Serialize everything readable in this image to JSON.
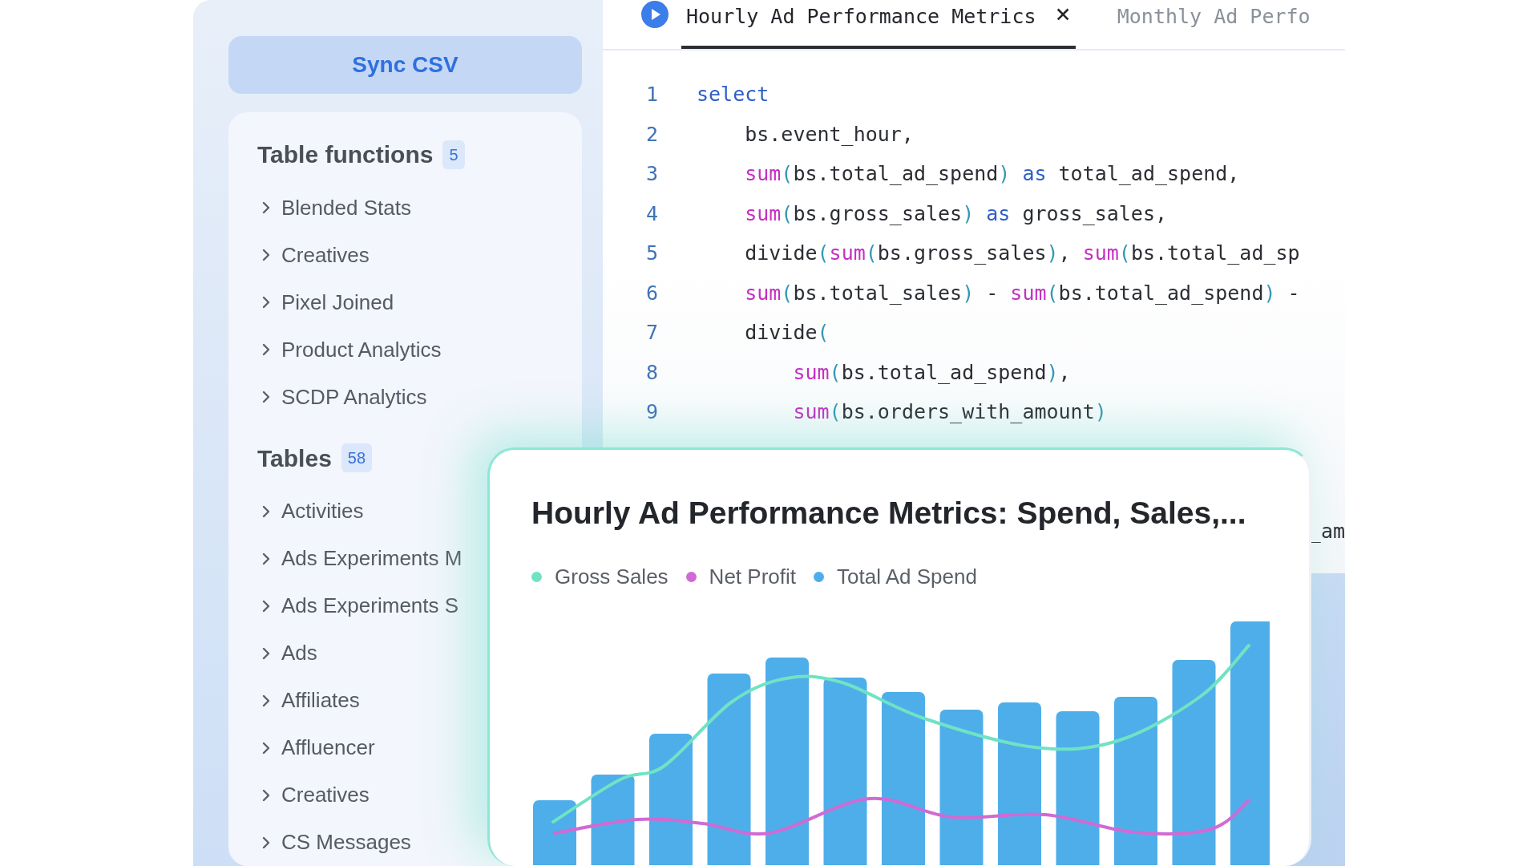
{
  "sidebar": {
    "sync_button": "Sync CSV",
    "sections": [
      {
        "title": "Table functions",
        "count": "5",
        "items": [
          "Blended Stats",
          "Creatives",
          "Pixel Joined",
          "Product Analytics",
          "SCDP Analytics"
        ]
      },
      {
        "title": "Tables",
        "count": "58",
        "items": [
          "Activities",
          "Ads Experiments M",
          "Ads Experiments S",
          "Ads",
          "Affiliates",
          "Affluencer",
          "Creatives",
          "CS Messages"
        ]
      }
    ]
  },
  "tabs": [
    {
      "label": "Hourly Ad Performance Metrics",
      "selected": true,
      "close": "×"
    },
    {
      "label": "Monthly Ad Perfo",
      "selected": false
    }
  ],
  "code": {
    "lines": [
      {
        "number": "1",
        "tokens": [
          {
            "kind": "kw",
            "text": "select"
          }
        ]
      },
      {
        "number": "2",
        "tokens": [
          {
            "kind": "plain",
            "text": "    bs.event_hour,"
          }
        ]
      },
      {
        "number": "3",
        "tokens": [
          {
            "kind": "fn",
            "text": "    sum"
          },
          {
            "kind": "paren",
            "text": "("
          },
          {
            "kind": "plain",
            "text": "bs.total_ad_spend"
          },
          {
            "kind": "paren",
            "text": ")"
          },
          {
            "kind": "kw",
            "text": " as"
          },
          {
            "kind": "plain",
            "text": " total_ad_spend,"
          }
        ]
      },
      {
        "number": "4",
        "tokens": [
          {
            "kind": "fn",
            "text": "    sum"
          },
          {
            "kind": "paren",
            "text": "("
          },
          {
            "kind": "plain",
            "text": "bs.gross_sales"
          },
          {
            "kind": "paren",
            "text": ")"
          },
          {
            "kind": "kw",
            "text": " as"
          },
          {
            "kind": "plain",
            "text": " gross_sales,"
          }
        ]
      },
      {
        "number": "5",
        "tokens": [
          {
            "kind": "plain",
            "text": "    divide"
          },
          {
            "kind": "paren",
            "text": "("
          },
          {
            "kind": "fn",
            "text": "sum"
          },
          {
            "kind": "paren",
            "text": "("
          },
          {
            "kind": "plain",
            "text": "bs.gross_sales"
          },
          {
            "kind": "paren",
            "text": ")"
          },
          {
            "kind": "plain",
            "text": ", "
          },
          {
            "kind": "fn",
            "text": "sum"
          },
          {
            "kind": "paren",
            "text": "("
          },
          {
            "kind": "plain",
            "text": "bs.total_ad_sp"
          }
        ]
      },
      {
        "number": "6",
        "tokens": [
          {
            "kind": "fn",
            "text": "    sum"
          },
          {
            "kind": "paren",
            "text": "("
          },
          {
            "kind": "plain",
            "text": "bs.total_sales"
          },
          {
            "kind": "paren",
            "text": ")"
          },
          {
            "kind": "plain",
            "text": " - "
          },
          {
            "kind": "fn",
            "text": "sum"
          },
          {
            "kind": "paren",
            "text": "("
          },
          {
            "kind": "plain",
            "text": "bs.total_ad_spend"
          },
          {
            "kind": "paren",
            "text": ")"
          },
          {
            "kind": "plain",
            "text": " -"
          }
        ]
      },
      {
        "number": "7",
        "tokens": [
          {
            "kind": "plain",
            "text": "    divide"
          },
          {
            "kind": "paren",
            "text": "("
          }
        ]
      },
      {
        "number": "8",
        "tokens": [
          {
            "kind": "fn",
            "text": "        sum"
          },
          {
            "kind": "paren",
            "text": "("
          },
          {
            "kind": "plain",
            "text": "bs.total_ad_spend"
          },
          {
            "kind": "paren",
            "text": ")"
          },
          {
            "kind": "plain",
            "text": ","
          }
        ]
      },
      {
        "number": "9",
        "tokens": [
          {
            "kind": "fn",
            "text": "        sum"
          },
          {
            "kind": "paren",
            "text": "("
          },
          {
            "kind": "plain",
            "text": "bs.orders_with_amount"
          },
          {
            "kind": "paren",
            "text": ")"
          }
        ]
      }
    ],
    "fragment": "_am"
  },
  "chart_card": {
    "title": "Hourly Ad Performance Metrics: Spend, Sales,...",
    "legend": [
      {
        "label": "Gross Sales",
        "color": "#6fe3c4"
      },
      {
        "label": "Net Profit",
        "color": "#d06ad4"
      },
      {
        "label": "Total Ad Spend",
        "color": "#4eaeea"
      }
    ]
  }
}
